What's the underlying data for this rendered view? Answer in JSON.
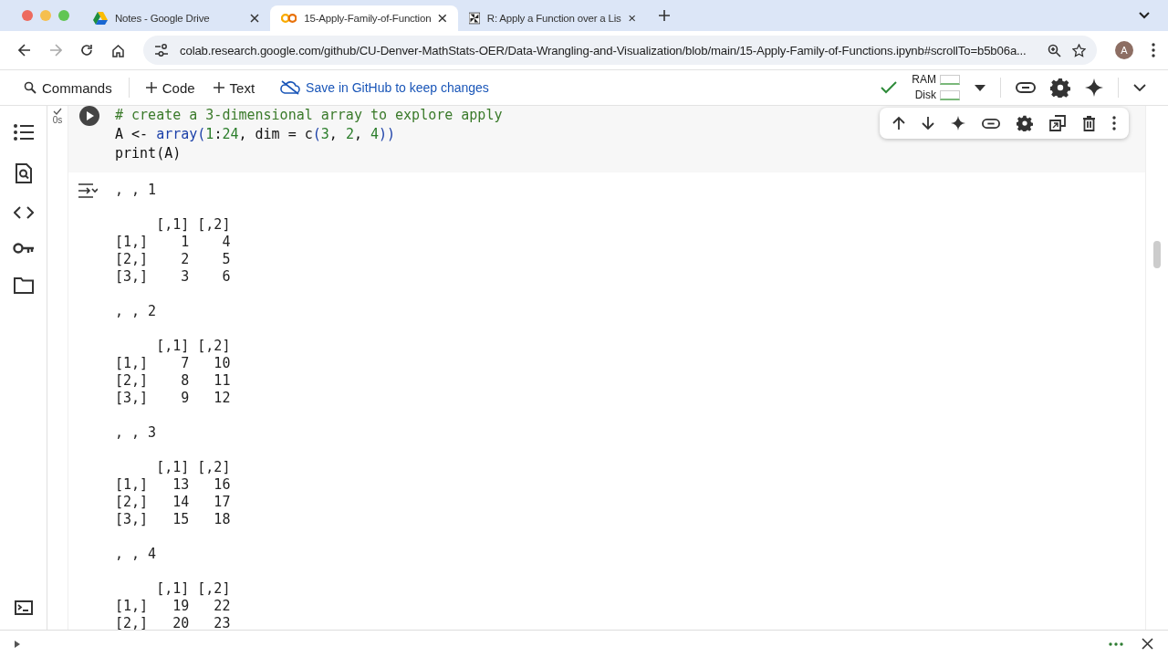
{
  "browser": {
    "tabs": [
      {
        "title": "Notes - Google Drive",
        "kind": "drive",
        "selected": false
      },
      {
        "title": "15-Apply-Family-of-Function",
        "kind": "colab",
        "selected": true
      },
      {
        "title": "R: Apply a Function over a Lis",
        "kind": "r",
        "selected": false
      }
    ],
    "url": "colab.research.google.com/github/CU-Denver-MathStats-OER/Data-Wrangling-and-Visualization/blob/main/15-Apply-Family-of-Functions.ipynb#scrollTo=b5b06a...",
    "avatar": "A"
  },
  "toolbar": {
    "commands": "Commands",
    "add_code": "Code",
    "add_text": "Text",
    "save": "Save in GitHub to keep changes",
    "connected": true,
    "ram": "RAM",
    "disk": "Disk"
  },
  "cell": {
    "executed": true,
    "runtime": "0s",
    "code": [
      [
        {
          "kind": "comment",
          "text": "# create a 3-dimensional array to explore apply"
        }
      ],
      [
        {
          "kind": "plain",
          "text": "A <- "
        },
        {
          "kind": "func",
          "text": "array("
        },
        {
          "kind": "number",
          "text": "1"
        },
        {
          "kind": "plain",
          "text": ":"
        },
        {
          "kind": "number",
          "text": "24"
        },
        {
          "kind": "plain",
          "text": ", dim = c"
        },
        {
          "kind": "func",
          "text": "("
        },
        {
          "kind": "number",
          "text": "3"
        },
        {
          "kind": "plain",
          "text": ", "
        },
        {
          "kind": "number",
          "text": "2"
        },
        {
          "kind": "plain",
          "text": ", "
        },
        {
          "kind": "number",
          "text": "4"
        },
        {
          "kind": "func",
          "text": "))"
        }
      ],
      [
        {
          "kind": "plain",
          "text": "print(A)"
        }
      ]
    ]
  },
  "output": [
    {
      "slice": ", , 1",
      "columns": "     [,1] [,2]",
      "rows": [
        "[1,]    1    4",
        "[2,]    2    5",
        "[3,]    3    6"
      ]
    },
    {
      "slice": ", , 2",
      "columns": "     [,1] [,2]",
      "rows": [
        "[1,]    7   10",
        "[2,]    8   11",
        "[3,]    9   12"
      ]
    },
    {
      "slice": ", , 3",
      "columns": "     [,1] [,2]",
      "rows": [
        "[1,]   13   16",
        "[2,]   14   17",
        "[3,]   15   18"
      ]
    },
    {
      "slice": ", , 4",
      "columns": "     [,1] [,2]",
      "rows": [
        "[1,]   19   22",
        "[2,]   20   23"
      ]
    }
  ]
}
